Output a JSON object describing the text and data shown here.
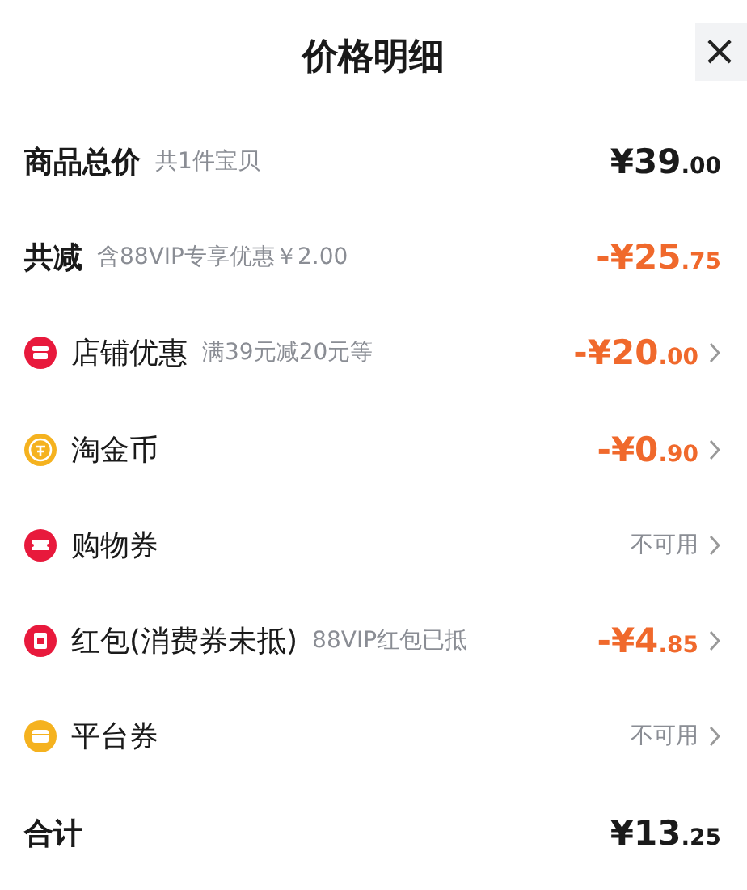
{
  "header": {
    "title": "价格明细",
    "close": "×"
  },
  "rows": [
    {
      "kind": "summary",
      "label": "商品总价",
      "note": "共1件宝贝",
      "amount": {
        "discount": false,
        "main": "¥39",
        "fraction": ".00"
      },
      "chevron": false
    },
    {
      "kind": "summary",
      "label": "共减",
      "note": "含88VIP专享优惠￥2.00",
      "amount": {
        "discount": true,
        "main": "-¥25",
        "fraction": ".75"
      },
      "chevron": false
    },
    {
      "kind": "shop",
      "label": "店铺优惠",
      "note": "满39元减20元等",
      "amount": {
        "discount": true,
        "main": "-¥20",
        "fraction": ".00"
      },
      "chevron": true
    },
    {
      "kind": "coin",
      "label": "淘金币",
      "amount": {
        "discount": true,
        "main": "-¥0",
        "fraction": ".90"
      },
      "chevron": true
    },
    {
      "kind": "ticket",
      "label": "购物券",
      "status": "不可用",
      "chevron": true
    },
    {
      "kind": "packet",
      "label": "红包(消费券未抵)",
      "note": "88VIP红包已抵",
      "amount": {
        "discount": true,
        "main": "-¥4",
        "fraction": ".85"
      },
      "chevron": true
    },
    {
      "kind": "wallet",
      "label": "平台券",
      "status": "不可用",
      "chevron": true
    },
    {
      "kind": "summary",
      "label": "合计",
      "amount": {
        "discount": false,
        "main": "¥13",
        "fraction": ".25"
      },
      "chevron": false
    }
  ]
}
